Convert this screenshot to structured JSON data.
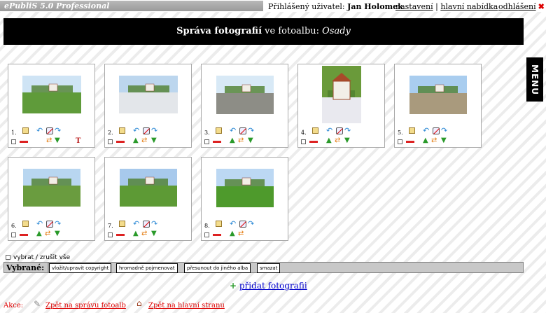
{
  "topbar": {
    "app_title": "ePubliS 5.0 Professional",
    "user_label": "Přihlášený uživatel:",
    "user_name": "Jan Holomek",
    "settings_link": "nastavení",
    "separator": "|",
    "main_menu_link": "hlavní nabídka",
    "logout_link": "odhlášení"
  },
  "header": {
    "title_bold": "Správa fotografií",
    "title_middle": " ve fotoalbu: ",
    "album_name": "Osady"
  },
  "menu_tab": {
    "label": "MENU"
  },
  "photos": [
    {
      "num": "1.",
      "scene": "field-village",
      "sky": "#cfe4f5",
      "ground": "#5f9b3a"
    },
    {
      "num": "2.",
      "scene": "winter-landscape",
      "sky": "#bcd6ee",
      "ground": "#e3e6ea"
    },
    {
      "num": "3.",
      "scene": "village-road",
      "sky": "#d8e9f6",
      "ground": "#8d8d86"
    },
    {
      "num": "4.",
      "scene": "chapel",
      "sky": "#6a9a3a",
      "ground": "#e9e9ef"
    },
    {
      "num": "5.",
      "scene": "farm-house",
      "sky": "#a9cdef",
      "ground": "#a99a7d"
    },
    {
      "num": "6.",
      "scene": "green-valley",
      "sky": "#b8d6f0",
      "ground": "#6a9c3f"
    },
    {
      "num": "7.",
      "scene": "village-houses",
      "sky": "#a7c9ec",
      "ground": "#5d9a35"
    },
    {
      "num": "8.",
      "scene": "green-meadow",
      "sky": "#bcd8f3",
      "ground": "#4e9a2c"
    }
  ],
  "select_all": "vybrat / zrušit vše",
  "actions_bar": {
    "label": "Vybrané:",
    "buttons": [
      "vložit/upravit copyright",
      "hromadně pojmenovat",
      "přesunout do jiného alba",
      "smazat"
    ]
  },
  "add_photos": {
    "plus": "+",
    "label": "přidat fotografii"
  },
  "footer": {
    "label": "Akce:",
    "back_album": "Zpět na správu fotoalb",
    "back_home": "Zpět na hlavní stranu"
  },
  "colors": {
    "header_bg": "#000000",
    "link_blue": "#0000cc",
    "action_red": "#dd0000",
    "green_arrow": "#2a9a2a"
  }
}
